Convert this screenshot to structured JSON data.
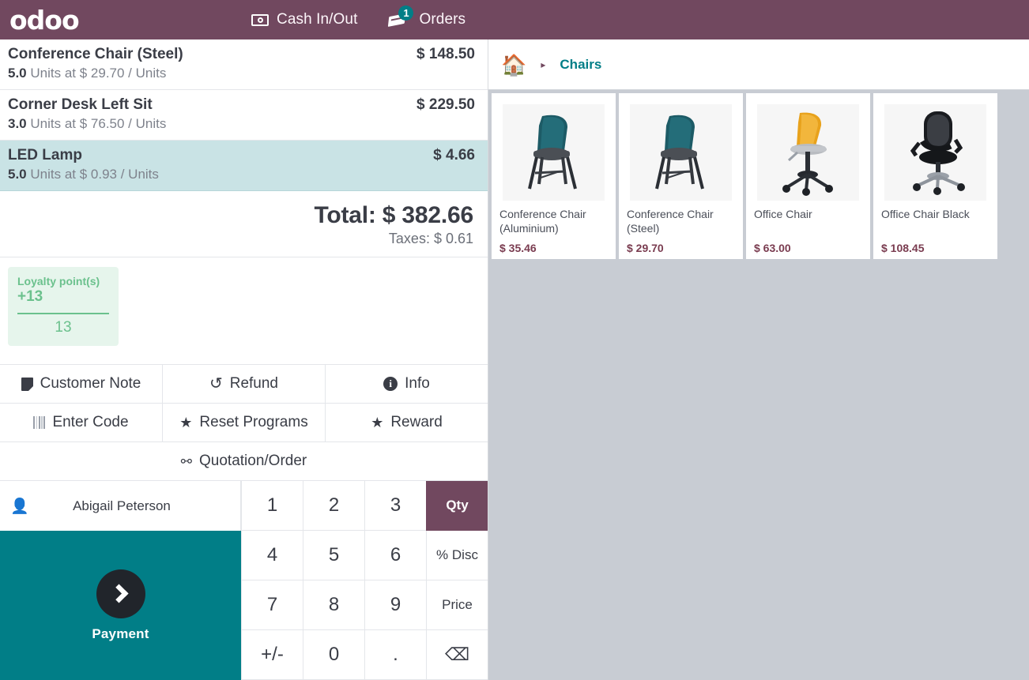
{
  "topbar": {
    "logo": "odoo",
    "cash_in_out": {
      "label": "Cash In/Out",
      "icon": "cash-icon"
    },
    "orders": {
      "label": "Orders",
      "icon": "receipt-icon",
      "badge": "1"
    },
    "bg_color": "#71485F"
  },
  "order": {
    "lines": [
      {
        "name": "Conference Chair (Steel)",
        "price": "$ 148.50",
        "qty": "5.0",
        "detail": "Units at $ 29.70 / Units",
        "selected": false
      },
      {
        "name": "Corner Desk Left Sit",
        "price": "$ 229.50",
        "qty": "3.0",
        "detail": "Units at $ 76.50 / Units",
        "selected": false
      },
      {
        "name": "LED Lamp",
        "price": "$ 4.66",
        "qty": "5.0",
        "detail": "Units at $ 0.93 / Units",
        "selected": true
      }
    ],
    "total_label": "Total: $ 382.66",
    "taxes_label": "Taxes: $ 0.61",
    "selected_row_color": "#C9E3E5"
  },
  "loyalty": {
    "title": "Loyalty point(s)",
    "delta": "+13",
    "total": "13",
    "color": "#6BC18D",
    "bg_color": "#E6F5EC"
  },
  "controls": {
    "row1": [
      {
        "label": "Customer Note",
        "icon": "note-icon"
      },
      {
        "label": "Refund",
        "icon": "refund-icon"
      },
      {
        "label": "Info",
        "icon": "info-icon"
      }
    ],
    "row2": [
      {
        "label": "Enter Code",
        "icon": "barcode-icon"
      },
      {
        "label": "Reset Programs",
        "icon": "star-icon"
      },
      {
        "label": "Reward",
        "icon": "star-icon"
      }
    ],
    "row3": [
      {
        "label": "Quotation/Order",
        "icon": "link-icon"
      }
    ]
  },
  "customer": {
    "name": "Abigail Peterson",
    "icon": "person-icon"
  },
  "payment": {
    "label": "Payment",
    "icon": "chevron-right-icon",
    "color": "#017E87"
  },
  "numpad": {
    "keys": [
      {
        "label": "1",
        "mode": "digit"
      },
      {
        "label": "2",
        "mode": "digit"
      },
      {
        "label": "3",
        "mode": "digit"
      },
      {
        "label": "Qty",
        "mode": "active"
      },
      {
        "label": "4",
        "mode": "digit"
      },
      {
        "label": "5",
        "mode": "digit"
      },
      {
        "label": "6",
        "mode": "digit"
      },
      {
        "label": "% Disc",
        "mode": "small"
      },
      {
        "label": "7",
        "mode": "digit"
      },
      {
        "label": "8",
        "mode": "digit"
      },
      {
        "label": "9",
        "mode": "digit"
      },
      {
        "label": "Price",
        "mode": "small"
      },
      {
        "label": "+/-",
        "mode": "digit"
      },
      {
        "label": "0",
        "mode": "digit"
      },
      {
        "label": ".",
        "mode": "digit"
      },
      {
        "label": "⌫",
        "mode": "backspace"
      }
    ],
    "active_color": "#71485F"
  },
  "breadcrumb": {
    "home_icon": "home-icon",
    "separator": "▸",
    "category": "Chairs",
    "accent_color": "#017E87"
  },
  "products": [
    {
      "name": "Conference Chair (Aluminium)",
      "price": "$ 35.46",
      "image": "teal-chair"
    },
    {
      "name": "Conference Chair (Steel)",
      "price": "$ 29.70",
      "image": "teal-chair"
    },
    {
      "name": "Office Chair",
      "price": "$ 63.00",
      "image": "yellow-office-chair"
    },
    {
      "name": "Office Chair Black",
      "price": "$ 108.45",
      "image": "black-office-chair"
    }
  ],
  "panel_bg_color": "#C8CCD3"
}
